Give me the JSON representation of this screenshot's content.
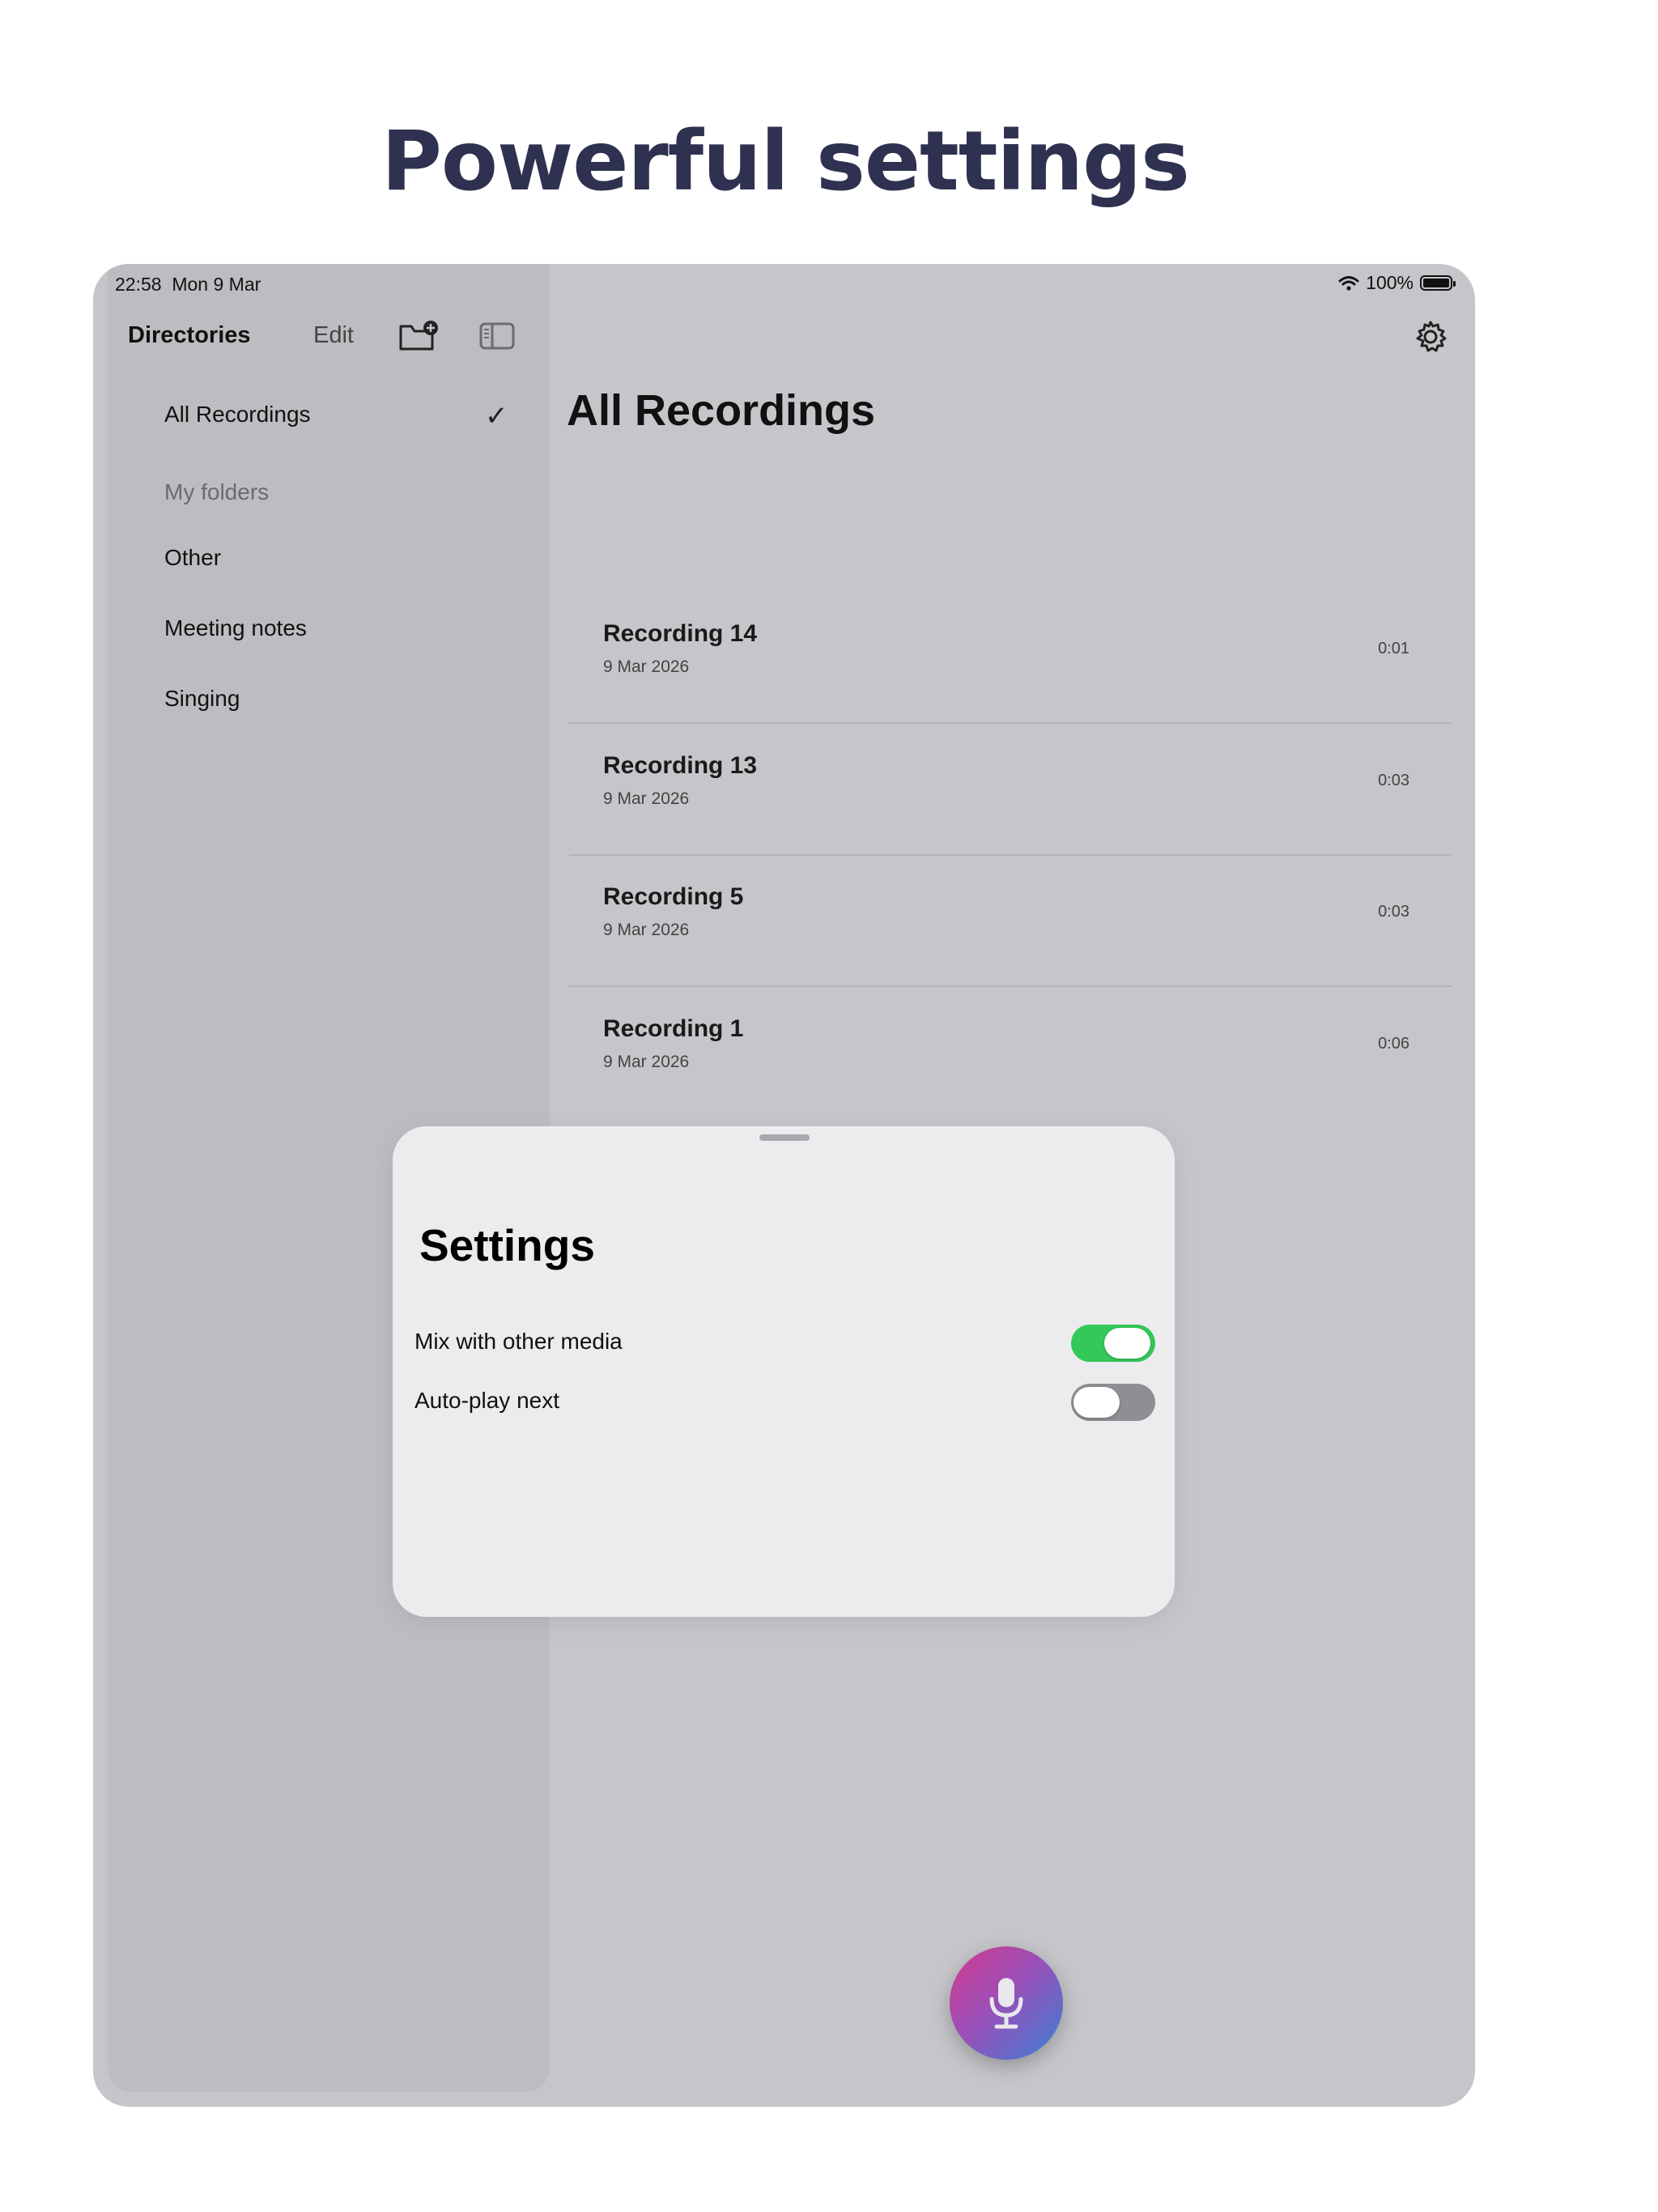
{
  "headline": "Powerful settings",
  "status": {
    "time": "22:58",
    "date": "Mon 9 Mar",
    "battery": "100%"
  },
  "sidebar": {
    "title": "Directories",
    "edit_label": "Edit",
    "all_recordings": "All Recordings",
    "section_label": "My folders",
    "folders": [
      "Other",
      "Meeting notes",
      "Singing"
    ]
  },
  "main": {
    "title": "All Recordings",
    "recordings": [
      {
        "name": "Recording 14",
        "date": "9 Mar 2026",
        "duration": "0:01"
      },
      {
        "name": "Recording 13",
        "date": "9 Mar 2026",
        "duration": "0:03"
      },
      {
        "name": "Recording 5",
        "date": "9 Mar 2026",
        "duration": "0:03"
      },
      {
        "name": "Recording 1",
        "date": "9 Mar 2026",
        "duration": "0:06"
      }
    ]
  },
  "settings": {
    "title": "Settings",
    "items": [
      {
        "label": "Mix with other media",
        "enabled": true
      },
      {
        "label": "Auto-play next",
        "enabled": false
      }
    ]
  },
  "colors": {
    "headline": "#2f3150",
    "toggle_on": "#34c759",
    "toggle_off": "#8e8e93"
  },
  "icons": [
    "wifi-icon",
    "battery-icon",
    "new-folder-icon",
    "sidebar-toggle-icon",
    "gear-icon",
    "checkmark-icon",
    "microphone-icon"
  ]
}
